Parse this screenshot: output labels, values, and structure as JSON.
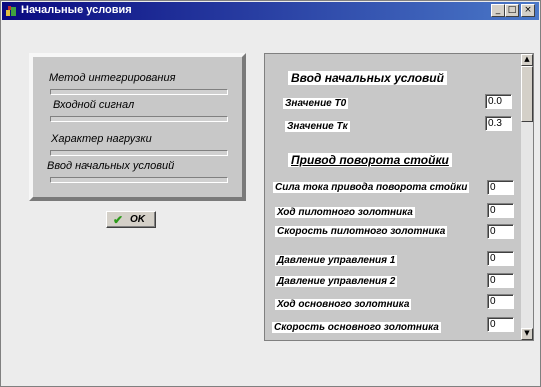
{
  "window": {
    "title": "Начальные условия",
    "controls": {
      "minimize": "_",
      "maximize": "□",
      "close": "×"
    }
  },
  "left_panel": {
    "items": [
      {
        "label": "Метод интегрирования"
      },
      {
        "label": "Входной сигнал"
      },
      {
        "label": "Характер нагрузки"
      },
      {
        "label": "Ввод начальных условий"
      }
    ]
  },
  "ok_button": {
    "label": "OK"
  },
  "right_panel": {
    "header1": "Ввод начальных условий",
    "t0_label": "Значение T0",
    "t0_value": "0.0",
    "tk_label": "Значение Tк",
    "tk_value": "0.3",
    "header2": "Привод поворота стойки",
    "params": [
      {
        "label": "Сила тока привода поворота стойки",
        "value": "0"
      },
      {
        "label": "Ход пилотного золотника",
        "value": "0"
      },
      {
        "label": "Скорость пилотного золотника",
        "value": "0"
      },
      {
        "label": "Давление управления 1",
        "value": "0"
      },
      {
        "label": "Давление управления 2",
        "value": "0"
      },
      {
        "label": "Ход основного золотника",
        "value": "0"
      },
      {
        "label": "Скорость основного золотника",
        "value": "0"
      }
    ]
  }
}
